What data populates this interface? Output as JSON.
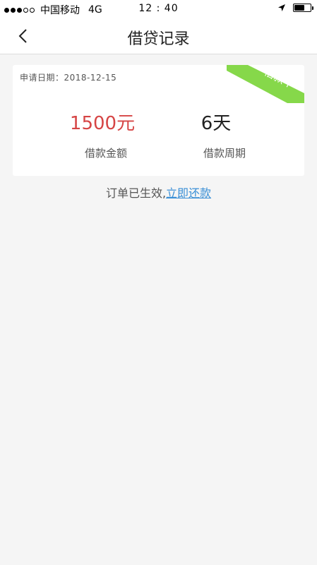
{
  "status_bar": {
    "carrier": "中国移动",
    "network": "4G",
    "time": "12 : 40",
    "signal_filled": 3,
    "signal_total": 5,
    "battery_level": 0.65
  },
  "nav": {
    "title": "借贷记录",
    "back_icon": "chevron-left-icon"
  },
  "record": {
    "apply_date_label": "申请日期：",
    "apply_date": "2018-12-15",
    "status": "借款中",
    "amount": "1500元",
    "amount_label": "借款金额",
    "term": "6天",
    "term_label": "借款周期"
  },
  "footer": {
    "message": "订单已生效,",
    "link_text": "立即还款"
  },
  "colors": {
    "ribbon": "#86d84a",
    "amount": "#d64545",
    "link": "#3a8fd6",
    "background": "#f5f5f5"
  }
}
